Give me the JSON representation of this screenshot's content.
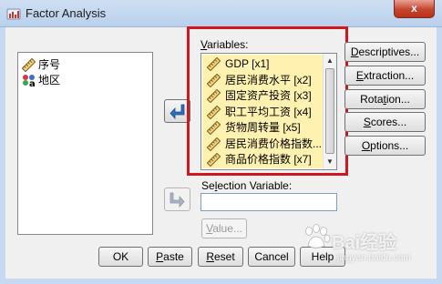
{
  "window": {
    "title": "Factor Analysis",
    "close_glyph": "x"
  },
  "source_list": {
    "items": [
      {
        "label": "序号",
        "icon": "scale-ruler-icon"
      },
      {
        "label": "地区",
        "icon": "nominal-variable-icon"
      }
    ]
  },
  "variables": {
    "label": "Variables:",
    "items": [
      {
        "label": "GDP [x1]",
        "icon": "scale-ruler-icon"
      },
      {
        "label": "居民消费水平 [x2]",
        "icon": "scale-ruler-icon"
      },
      {
        "label": "固定资产投资 [x3]",
        "icon": "scale-ruler-icon"
      },
      {
        "label": "职工平均工资 [x4]",
        "icon": "scale-ruler-icon"
      },
      {
        "label": "货物周转量 [x5]",
        "icon": "scale-ruler-icon"
      },
      {
        "label": "居民消费价格指数...",
        "icon": "scale-ruler-icon"
      },
      {
        "label": "商品价格指数 [x7]",
        "icon": "scale-ruler-icon"
      }
    ]
  },
  "selection": {
    "label": "Selection Variable:",
    "value": "",
    "value_button": "Value..."
  },
  "side_buttons": {
    "descriptives": "Descriptives...",
    "extraction": "Extraction...",
    "rotation": "Rotation...",
    "scores": "Scores...",
    "options": "Options..."
  },
  "bottom_buttons": {
    "ok": "OK",
    "paste": "Paste",
    "reset": "Reset",
    "cancel": "Cancel",
    "help": "Help"
  },
  "watermark": {
    "text": "Bai经验",
    "url": "jingyan.baidu.com"
  },
  "colors": {
    "selected_rows": "#fff2b0",
    "highlight_box": "#d0161e",
    "move_arrow": "#2d6fb8"
  }
}
